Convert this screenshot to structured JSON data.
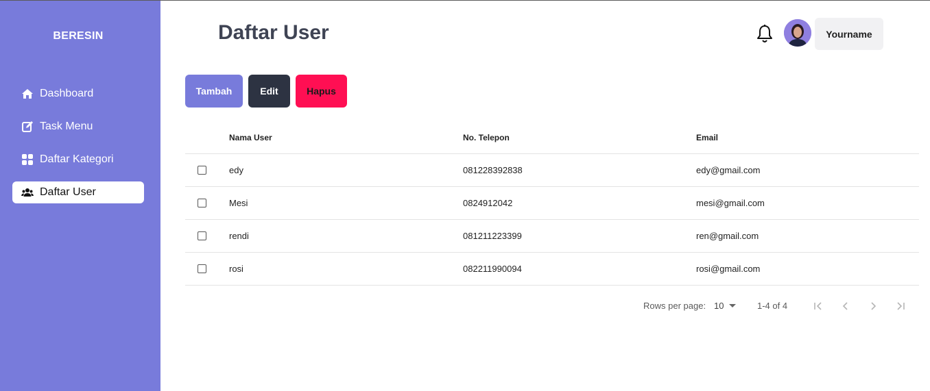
{
  "sidebar": {
    "brand": "BERESIN",
    "items": [
      {
        "label": "Dashboard",
        "icon": "home-icon"
      },
      {
        "label": "Task Menu",
        "icon": "edit-icon"
      },
      {
        "label": "Daftar Kategori",
        "icon": "grid-icon"
      },
      {
        "label": "Daftar User",
        "icon": "users-icon",
        "active": true
      }
    ]
  },
  "header": {
    "title": "Daftar User",
    "username": "Yourname"
  },
  "toolbar": {
    "add_label": "Tambah",
    "edit_label": "Edit",
    "delete_label": "Hapus"
  },
  "table": {
    "columns": [
      "Nama User",
      "No. Telepon",
      "Email"
    ],
    "rows": [
      {
        "name": "edy",
        "phone": "081228392838",
        "email": "edy@gmail.com"
      },
      {
        "name": "Mesi",
        "phone": "0824912042",
        "email": "mesi@gmail.com"
      },
      {
        "name": "rendi",
        "phone": "081211223399",
        "email": "ren@gmail.com"
      },
      {
        "name": "rosi",
        "phone": "082211990094",
        "email": "rosi@gmail.com"
      }
    ]
  },
  "pagination": {
    "rows_per_page_label": "Rows per page:",
    "rows_per_page_value": "10",
    "range": "1-4 of 4"
  },
  "colors": {
    "sidebar": "#787bdb",
    "primary": "#787bdb",
    "dark": "#2d3342",
    "danger": "#ff0f53"
  }
}
